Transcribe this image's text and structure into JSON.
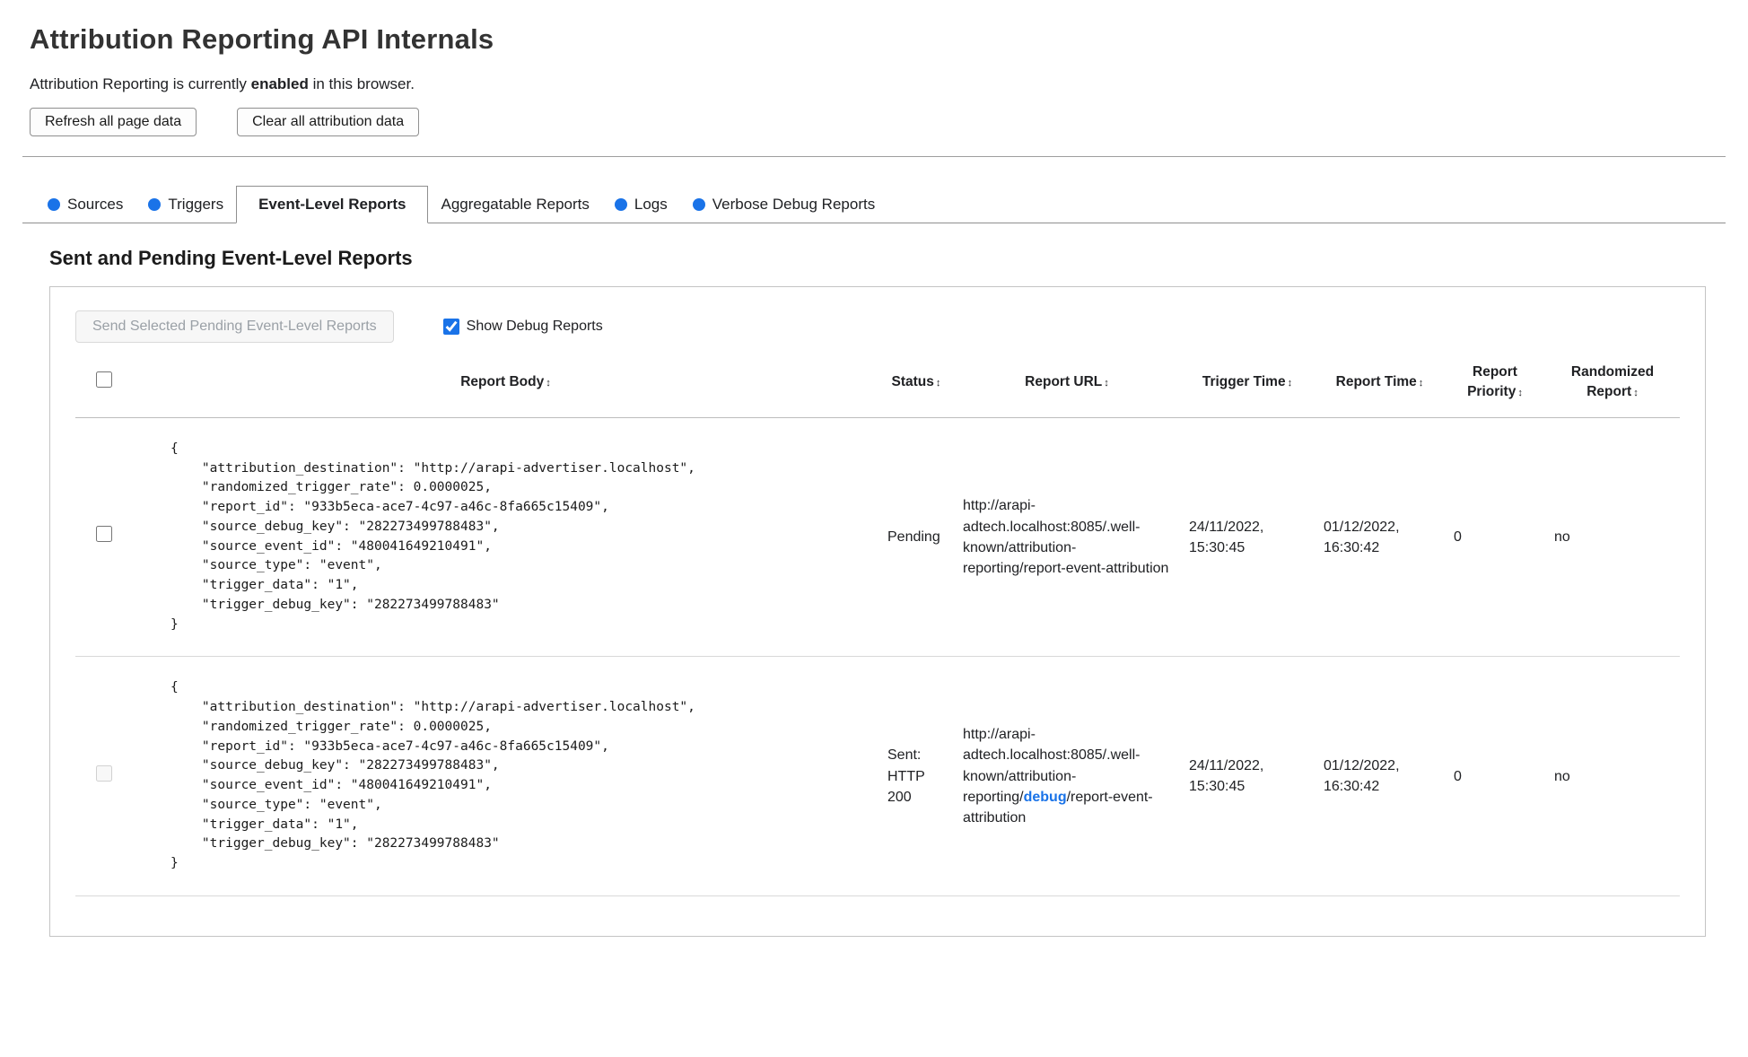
{
  "accent_color": "#1a73e8",
  "page": {
    "title": "Attribution Reporting API Internals",
    "status_prefix": "Attribution Reporting is currently ",
    "status_bold": "enabled",
    "status_suffix": " in this browser.",
    "refresh_button_label": "Refresh all page data",
    "clear_button_label": "Clear all attribution data"
  },
  "tabs": [
    {
      "label": "Sources",
      "has_dot": true,
      "active": false
    },
    {
      "label": "Triggers",
      "has_dot": true,
      "active": false
    },
    {
      "label": "Event-Level Reports",
      "has_dot": false,
      "active": true
    },
    {
      "label": "Aggregatable Reports",
      "has_dot": false,
      "active": false
    },
    {
      "label": "Logs",
      "has_dot": true,
      "active": false
    },
    {
      "label": "Verbose Debug Reports",
      "has_dot": true,
      "active": false
    }
  ],
  "section": {
    "heading": "Sent and Pending Event-Level Reports",
    "send_button_label": "Send Selected Pending Event-Level Reports",
    "send_button_enabled": false,
    "show_debug_label": "Show Debug Reports",
    "show_debug_checked": true
  },
  "table": {
    "sort_indicator": "↕",
    "headers": [
      "Report Body",
      "Status",
      "Report URL",
      "Trigger Time",
      "Report Time",
      "Report Priority",
      "Randomized Report"
    ],
    "rows": [
      {
        "checked": false,
        "checkbox_enabled": true,
        "report_body": "{\n    \"attribution_destination\": \"http://arapi-advertiser.localhost\",\n    \"randomized_trigger_rate\": 0.0000025,\n    \"report_id\": \"933b5eca-ace7-4c97-a46c-8fa665c15409\",\n    \"source_debug_key\": \"282273499788483\",\n    \"source_event_id\": \"480041649210491\",\n    \"source_type\": \"event\",\n    \"trigger_data\": \"1\",\n    \"trigger_debug_key\": \"282273499788483\"\n}",
        "status": "Pending",
        "report_url": "http://arapi-adtech.localhost:8085/.well-known/attribution-reporting/report-event-attribution",
        "trigger_time": "24/11/2022, 15:30:45",
        "report_time": "01/12/2022, 16:30:42",
        "report_priority": "0",
        "randomized_report": "no"
      },
      {
        "checked": false,
        "checkbox_enabled": false,
        "report_body": "{\n    \"attribution_destination\": \"http://arapi-advertiser.localhost\",\n    \"randomized_trigger_rate\": 0.0000025,\n    \"report_id\": \"933b5eca-ace7-4c97-a46c-8fa665c15409\",\n    \"source_debug_key\": \"282273499788483\",\n    \"source_event_id\": \"480041649210491\",\n    \"source_type\": \"event\",\n    \"trigger_data\": \"1\",\n    \"trigger_debug_key\": \"282273499788483\"\n}",
        "status": "Sent: HTTP 200",
        "report_url_prefix": "http://arapi-adtech.localhost:8085/.well-known/attribution-reporting/",
        "report_url_debug": "debug",
        "report_url_suffix": "/report-event-attribution",
        "trigger_time": "24/11/2022, 15:30:45",
        "report_time": "01/12/2022, 16:30:42",
        "report_priority": "0",
        "randomized_report": "no"
      }
    ]
  }
}
